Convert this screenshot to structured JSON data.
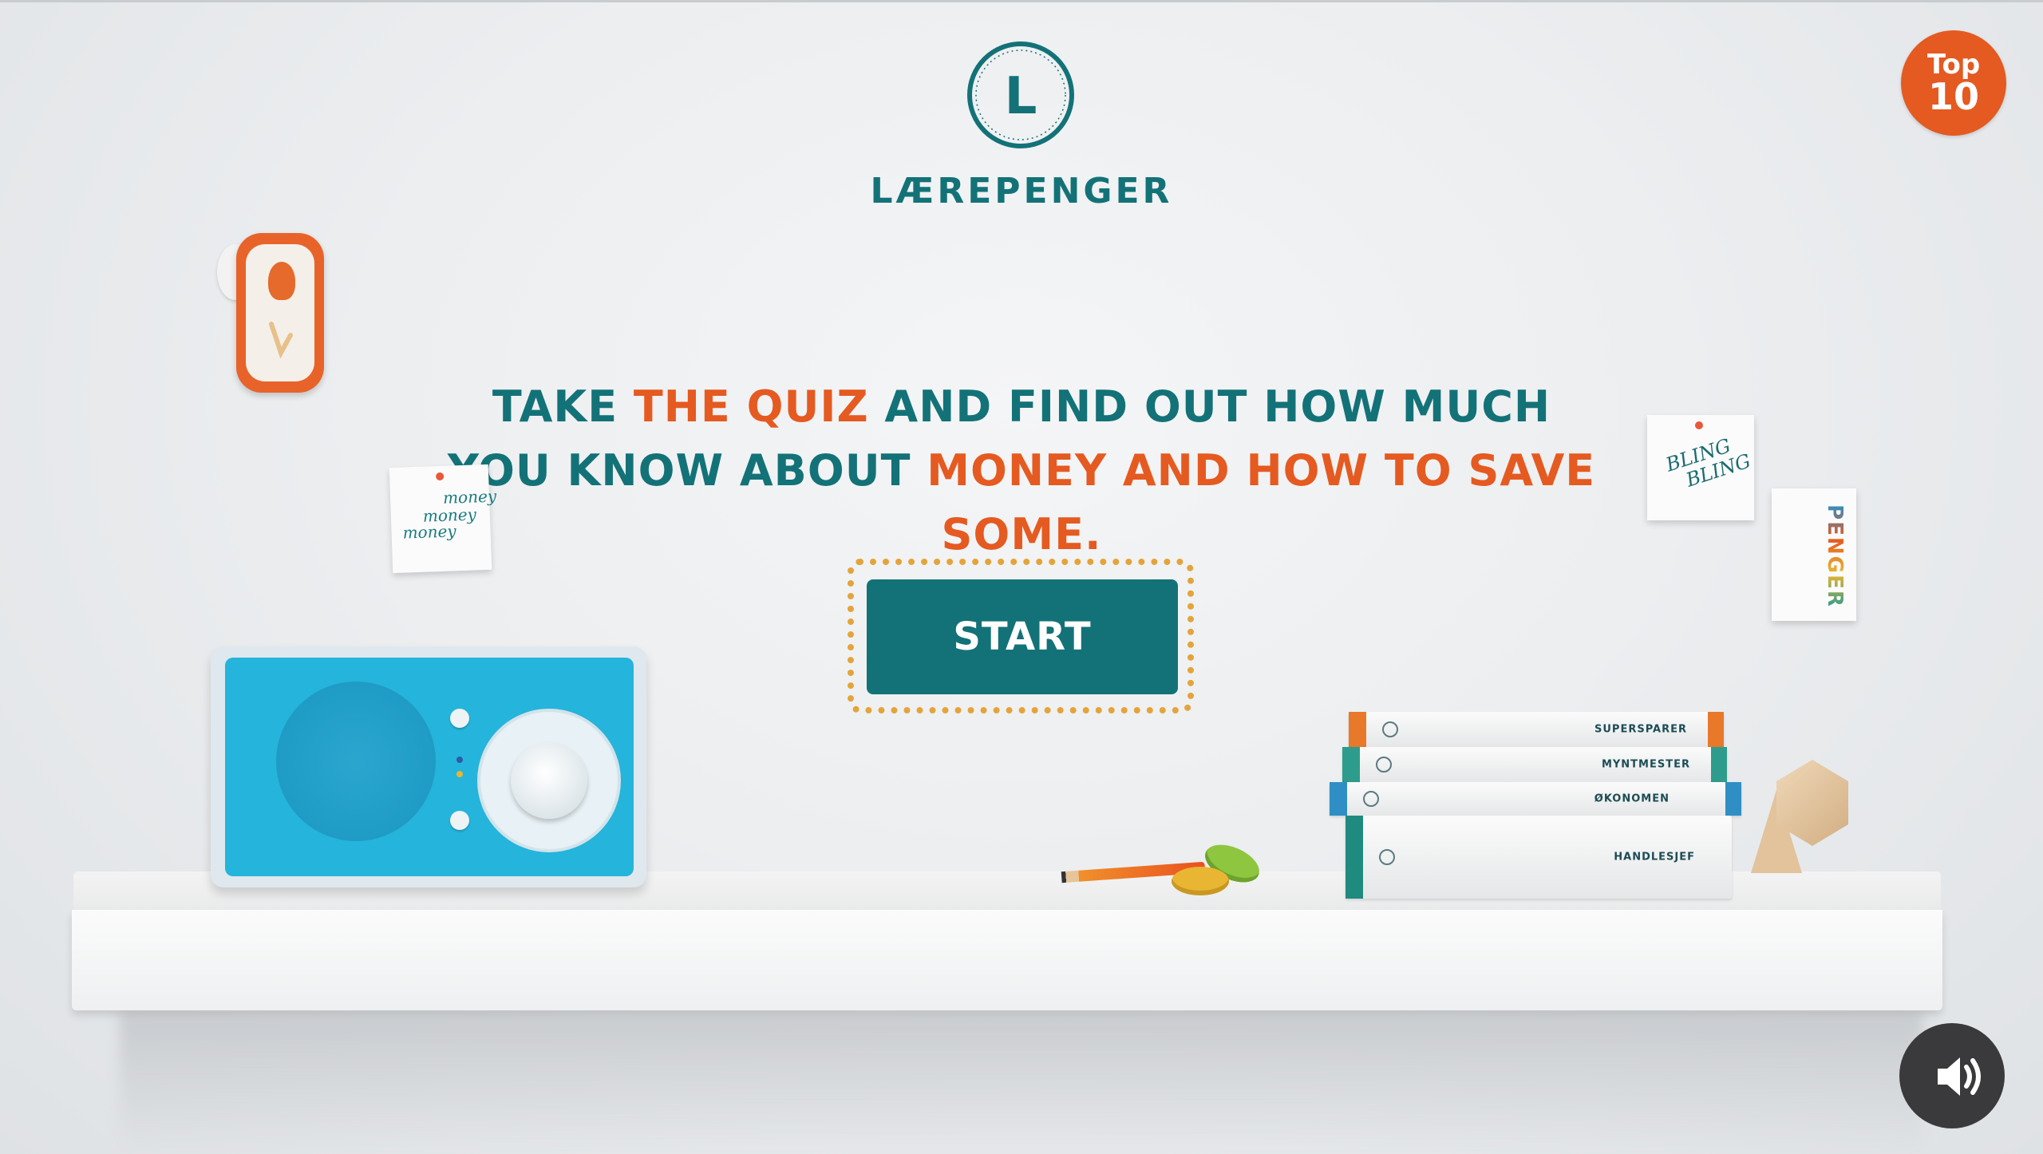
{
  "brand": {
    "logo_letter": "L",
    "name": "LÆREPENGER"
  },
  "badge": {
    "line1": "Top",
    "line2": "10"
  },
  "headline": {
    "line1": [
      {
        "text": "TAKE ",
        "color": "teal"
      },
      {
        "text": "THE QUIZ",
        "color": "orange"
      },
      {
        "text": " AND FIND OUT HOW MUCH",
        "color": "teal"
      }
    ],
    "line2": [
      {
        "text": "YOU KNOW ABOUT ",
        "color": "teal"
      },
      {
        "text": "MONEY AND HOW TO SAVE SOME.",
        "color": "orange"
      }
    ]
  },
  "start_button": {
    "label": "START"
  },
  "notes": {
    "money": [
      "money",
      "money",
      "money"
    ],
    "bling": [
      "BLING",
      "BLING"
    ],
    "penger": "PENGER"
  },
  "books": [
    {
      "title": "SUPERSPARER",
      "color": "#e8782a"
    },
    {
      "title": "MYNTMESTER",
      "color": "#2e9c8c"
    },
    {
      "title": "ØKONOMEN",
      "color": "#2f8fc4"
    },
    {
      "title": "HANDLESJEF",
      "color": "#1f8a7e"
    }
  ],
  "colors": {
    "teal": "#137277",
    "orange": "#e55a20",
    "badge": "#e45a20",
    "sound_bg": "#3a3a3c"
  },
  "icons": {
    "sound": "speaker-volume-icon",
    "logo": "coin-logo-icon"
  }
}
